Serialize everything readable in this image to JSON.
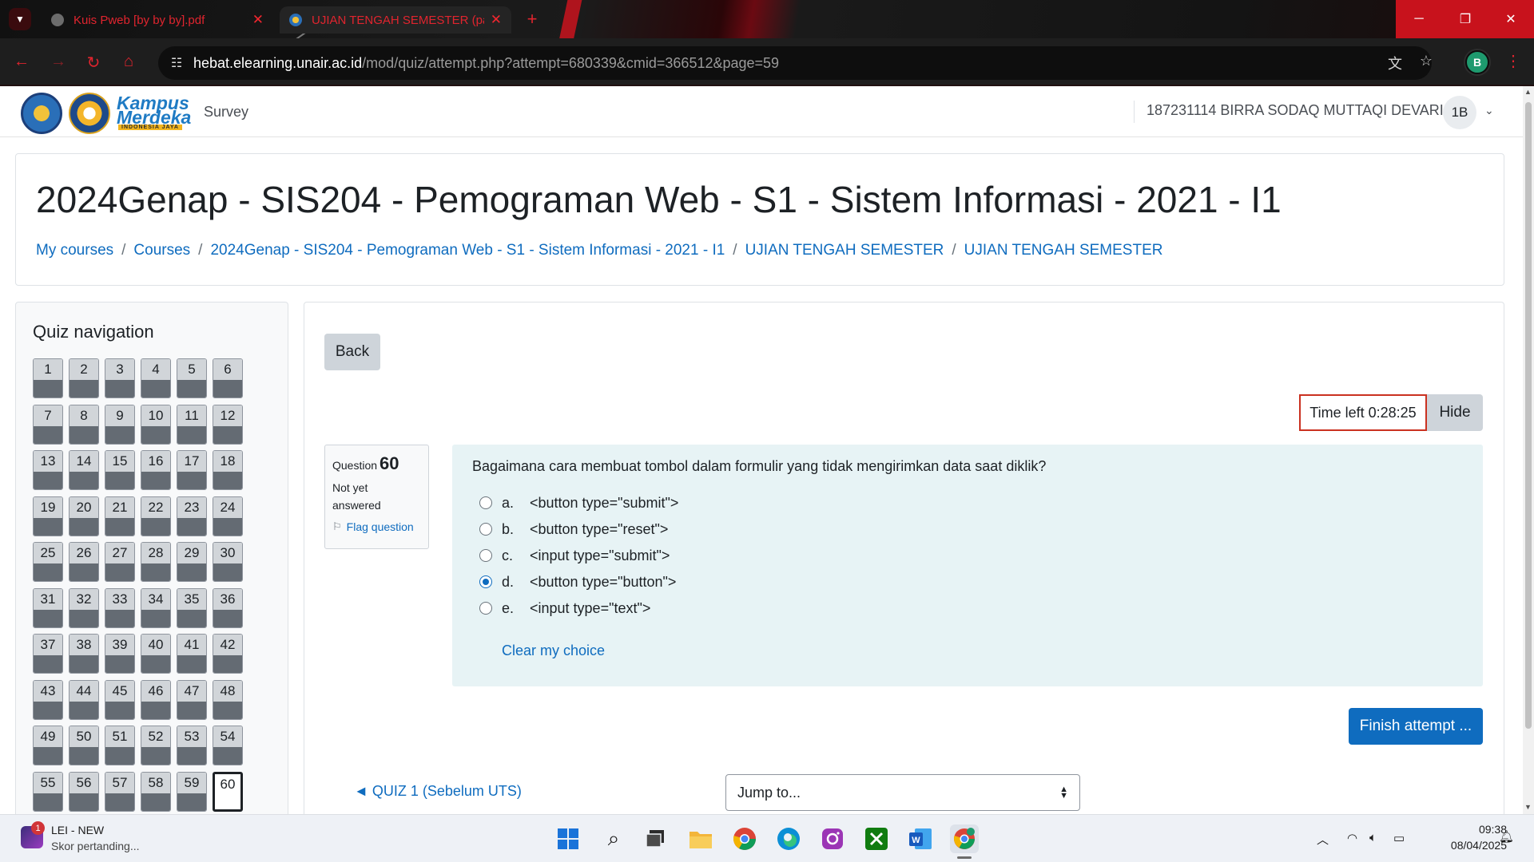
{
  "browser": {
    "tabs": [
      {
        "title": "Kuis Pweb [by by by].pdf",
        "active": false
      },
      {
        "title": "UJIAN TENGAH SEMESTER (pag",
        "active": true
      }
    ],
    "new_tab_symbol": "+",
    "url_host": "hebat.elearning.unair.ac.id",
    "url_path": "/mod/quiz/attempt.php?attempt=680339&cmid=366512&page=59",
    "profile_initial": "B",
    "accent_color": "#e0242e"
  },
  "navbar": {
    "survey_label": "Survey",
    "user_name": "187231114 BIRRA SODAQ MUTTAQI DEVARI",
    "user_initials": "1B",
    "logo_text_line1": "Kampus",
    "logo_text_line2": "Merdeka",
    "logo_text_line3": "INDONESIA JAYA"
  },
  "header": {
    "course_title": "2024Genap - SIS204 - Pemograman Web - S1 - Sistem Informasi - 2021 - I1",
    "breadcrumb": [
      "My courses",
      "Courses",
      "2024Genap - SIS204 - Pemograman Web - S1 - Sistem Informasi - 2021 - I1",
      "UJIAN TENGAH SEMESTER",
      "UJIAN TENGAH SEMESTER"
    ],
    "breadcrumb_separator": "/"
  },
  "quiz_nav": {
    "title": "Quiz navigation",
    "total": 60,
    "current": 60,
    "answered_color": "#646b73"
  },
  "attempt": {
    "back_label": "Back",
    "timer_label": "Time left 0:28:25",
    "hide_label": "Hide",
    "question_label": "Question",
    "question_number": "60",
    "state": "Not yet answered",
    "flag_label": "Flag question",
    "question_text": "Bagaimana cara membuat tombol dalam formulir yang tidak mengirimkan data saat diklik?",
    "answers": [
      {
        "letter": "a.",
        "text": "<button type=\"submit\">",
        "checked": false
      },
      {
        "letter": "b.",
        "text": "<button type=\"reset\">",
        "checked": false
      },
      {
        "letter": "c.",
        "text": "<input type=\"submit\">",
        "checked": false
      },
      {
        "letter": "d.",
        "text": "<button type=\"button\">",
        "checked": true
      },
      {
        "letter": "e.",
        "text": "<input type=\"text\">",
        "checked": false
      }
    ],
    "clear_label": "Clear my choice",
    "finish_label": "Finish attempt ...",
    "prev_link": "◄ QUIZ 1 (Sebelum UTS)",
    "jump_placeholder": "Jump to..."
  },
  "taskbar": {
    "widget_title": "LEI - NEW",
    "widget_subtitle": "Skor pertanding...",
    "widget_badge": "1",
    "time": "09:38",
    "date": "08/04/2025",
    "apps": [
      "start-icon",
      "search-icon",
      "task-view-icon",
      "file-explorer-icon",
      "chrome-icon",
      "edge-icon",
      "instagram-icon",
      "xbox-icon",
      "word-icon",
      "chrome-profile-icon"
    ]
  }
}
